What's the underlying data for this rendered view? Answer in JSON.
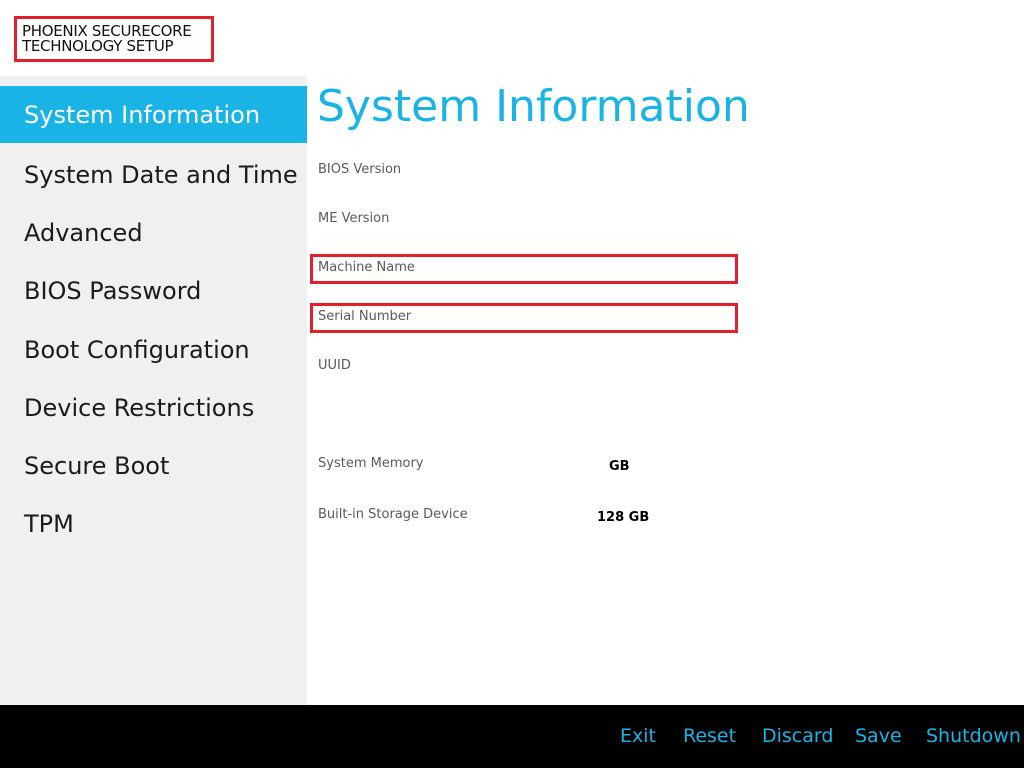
{
  "header": {
    "logo_line1": "PHOENIX SECURECORE",
    "logo_line2": "TECHNOLOGY SETUP"
  },
  "sidebar": {
    "items": [
      {
        "label": "System Information",
        "active": true
      },
      {
        "label": "System Date and Time",
        "active": false
      },
      {
        "label": "Advanced",
        "active": false
      },
      {
        "label": "BIOS Password",
        "active": false
      },
      {
        "label": "Boot Configuration",
        "active": false
      },
      {
        "label": "Device Restrictions",
        "active": false
      },
      {
        "label": "Secure Boot",
        "active": false
      },
      {
        "label": "TPM",
        "active": false
      }
    ]
  },
  "main": {
    "title": "System Information",
    "fields": [
      {
        "label": "BIOS Version",
        "value": ""
      },
      {
        "label": "ME Version",
        "value": ""
      },
      {
        "label": "Machine Name",
        "value": ""
      },
      {
        "label": "Serial Number",
        "value": ""
      },
      {
        "label": "UUID",
        "value": ""
      },
      {
        "label": "System Memory",
        "value": "GB"
      },
      {
        "label": "Built-in Storage Device",
        "value": "128 GB"
      }
    ]
  },
  "footer": {
    "exit_label": "Exit",
    "reset_label": "Reset",
    "discard_label": "Discard",
    "save_label": "Save",
    "shutdown_label": "Shutdown"
  },
  "colors": {
    "accent": "#1ab3e6",
    "highlight": "#e0202c",
    "sidebar_bg": "#f0f0f0",
    "footer_bg": "#000000"
  }
}
